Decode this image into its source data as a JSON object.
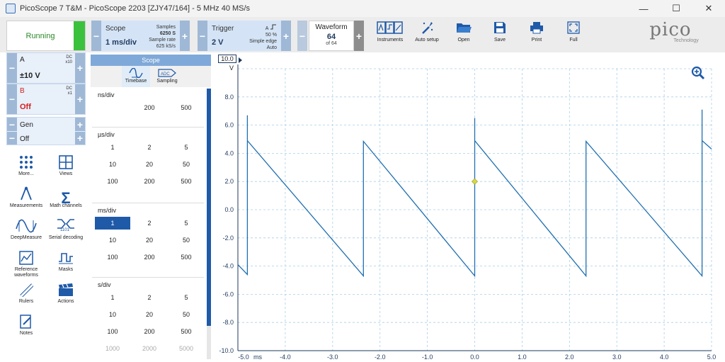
{
  "window": {
    "title": "PicoScope 7 T&M  - PicoScope 2203 [ZJY47/164] - 5 MHz 40 MS/s",
    "minimize": "—",
    "maximize": "☐",
    "close": "✕"
  },
  "toolbar": {
    "run_status": "Running",
    "scope": {
      "label": "Scope",
      "value": "1 ms/div",
      "samples_label": "Samples",
      "samples": "6250 S",
      "rate_label": "Sample rate",
      "rate": "625 kS/s"
    },
    "trigger": {
      "label": "Trigger",
      "value": "2 V",
      "channel": "A",
      "percent": "50 %",
      "type": "Simple edge",
      "mode": "Auto"
    },
    "waveform": {
      "label": "Waveform",
      "value": "64",
      "of": "of 64"
    },
    "buttons": [
      {
        "label": "Instruments",
        "icon": "instruments-icon"
      },
      {
        "label": "Auto setup",
        "icon": "auto-setup-icon"
      },
      {
        "label": "Open",
        "icon": "folder-open-icon"
      },
      {
        "label": "Save",
        "icon": "save-icon"
      },
      {
        "label": "Print",
        "icon": "print-icon"
      },
      {
        "label": "Full",
        "icon": "fullscreen-icon"
      }
    ],
    "logo": {
      "text": "pico",
      "sub": "Technology"
    }
  },
  "channels": [
    {
      "name": "A",
      "coupling": "DC",
      "probe": "x10",
      "range": "±10 V",
      "color": "#222222"
    },
    {
      "name": "B",
      "coupling": "DC",
      "probe": "x1",
      "range": "Off",
      "color": "#d22020"
    },
    {
      "name": "Gen",
      "coupling": "",
      "probe": "",
      "range": "Off",
      "color": "#222222"
    }
  ],
  "tools": [
    {
      "label": "More...",
      "icon": "more-dots-icon"
    },
    {
      "label": "Views",
      "icon": "views-grid-icon"
    },
    {
      "label": "Measurements",
      "icon": "measurements-icon"
    },
    {
      "label": "Math channels",
      "icon": "sigma-icon"
    },
    {
      "label": "DeepMeasure",
      "icon": "deepmeasure-icon"
    },
    {
      "label": "Serial decoding",
      "icon": "serial-decoding-icon"
    },
    {
      "label": "Reference waveforms",
      "icon": "reference-waveform-icon"
    },
    {
      "label": "Masks",
      "icon": "masks-icon"
    },
    {
      "label": "Rulers",
      "icon": "ruler-icon"
    },
    {
      "label": "Actions",
      "icon": "clapper-icon"
    },
    {
      "label": "Notes",
      "icon": "notes-icon"
    }
  ],
  "timebase_panel": {
    "header": "Scope",
    "tabs": [
      {
        "label": "Timebase",
        "active": true
      },
      {
        "label": "Sampling",
        "active": false
      }
    ],
    "sections": [
      {
        "title": "ns/div",
        "values": [
          "200",
          "500"
        ],
        "start_col": 1
      },
      {
        "title": "µs/div",
        "values": [
          "1",
          "2",
          "5",
          "10",
          "20",
          "50",
          "100",
          "200",
          "500"
        ],
        "start_col": 0
      },
      {
        "title": "ms/div",
        "values": [
          "1",
          "2",
          "5",
          "10",
          "20",
          "50",
          "100",
          "200",
          "500"
        ],
        "start_col": 0,
        "selected": "1"
      },
      {
        "title": "s/div",
        "values": [
          "1",
          "2",
          "5",
          "10",
          "20",
          "50",
          "100",
          "200",
          "500",
          "1000",
          "2000",
          "5000"
        ],
        "start_col": 0
      }
    ]
  },
  "chart_data": {
    "type": "line",
    "ylabel": "V",
    "y_range_label": "10.0",
    "xlabel_unit": "ms",
    "xlim": [
      -5.0,
      5.0
    ],
    "ylim": [
      -10.0,
      10.0
    ],
    "x_ticks": [
      "-5.0",
      "-4.0",
      "-3.0",
      "-2.0",
      "-1.0",
      "0.0",
      "1.0",
      "2.0",
      "3.0",
      "4.0",
      "5.0"
    ],
    "y_ticks": [
      "8.0",
      "6.0",
      "4.0",
      "2.0",
      "0.0",
      "-2.0",
      "-4.0",
      "-6.0",
      "-8.0",
      "-10.0"
    ],
    "grid": true,
    "series": [
      {
        "color": "#1f6fb0",
        "x": [
          -5.0,
          -4.8,
          -4.8,
          -4.8,
          -2.35,
          -2.35,
          -2.35,
          0.0,
          0.0,
          0.0,
          2.35,
          2.35,
          2.35,
          4.8,
          4.8,
          4.8,
          5.0
        ],
        "y": [
          -3.9,
          -4.6,
          6.7,
          4.9,
          -4.7,
          4.85,
          4.85,
          -4.7,
          6.5,
          4.9,
          -4.7,
          4.85,
          4.85,
          -4.7,
          7.1,
          4.9,
          4.3
        ]
      }
    ],
    "trigger_marker": {
      "x": 0.0,
      "y": 2.0,
      "color": "#d8d840"
    }
  }
}
